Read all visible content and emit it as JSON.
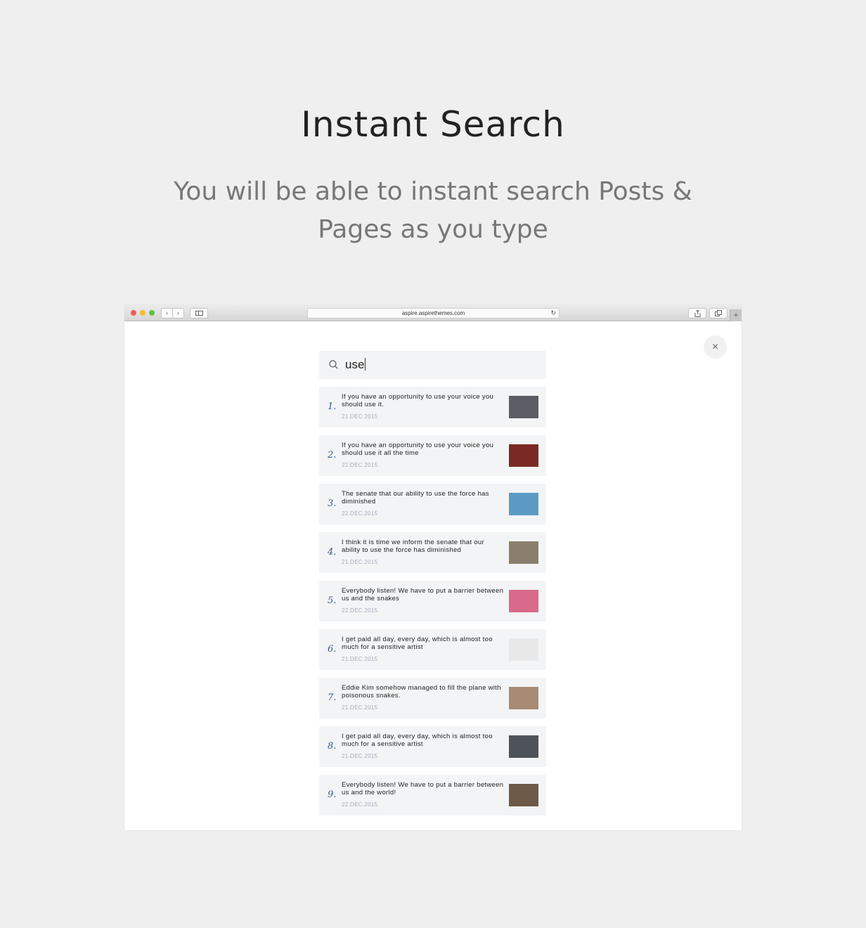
{
  "hero": {
    "title": "Instant Search",
    "subtitle": "You will be able to instant search Posts & Pages as you type"
  },
  "browser": {
    "url": "aspire.aspirethemes.com",
    "nav_back": "‹",
    "nav_forward": "›",
    "reload": "↻",
    "new_tab": "+"
  },
  "search": {
    "query": "use",
    "close": "×"
  },
  "results": [
    {
      "num": "1.",
      "title": "If you have an opportunity to use your voice you should use it.",
      "date": "21.DEC.2015",
      "thumb_color": "#5a5d64"
    },
    {
      "num": "2.",
      "title": "If you have an opportunity to use your voice you should use it all the time",
      "date": "22.DEC.2015",
      "thumb_color": "#7a2a22"
    },
    {
      "num": "3.",
      "title": "The senate that our ability to use the force has diminished",
      "date": "22.DEC.2015",
      "thumb_color": "#5b9bc3"
    },
    {
      "num": "4.",
      "title": "I think it is time we inform the senate that our ability to use the force has diminished",
      "date": "21.DEC.2015",
      "thumb_color": "#8a7f6c"
    },
    {
      "num": "5.",
      "title": "Everybody listen! We have to put a barrier between us and the snakes",
      "date": "22.DEC.2015",
      "thumb_color": "#d96a8c"
    },
    {
      "num": "6.",
      "title": "I get paid all day, every day, which is almost too much for a sensitive artist",
      "date": "21.DEC.2015",
      "thumb_color": "#e8e8e8"
    },
    {
      "num": "7.",
      "title": "Eddie Kim somehow managed to fill the plane with poisonous snakes.",
      "date": "21.DEC.2015",
      "thumb_color": "#a88b74"
    },
    {
      "num": "8.",
      "title": "I get paid all day, every day, which is almost too much for a sensitive artist",
      "date": "21.DEC.2015",
      "thumb_color": "#4d5358"
    },
    {
      "num": "9.",
      "title": "Everybody listen! We have to put a barrier between us and the world!",
      "date": "22.DEC.2015",
      "thumb_color": "#6e5a48"
    }
  ]
}
